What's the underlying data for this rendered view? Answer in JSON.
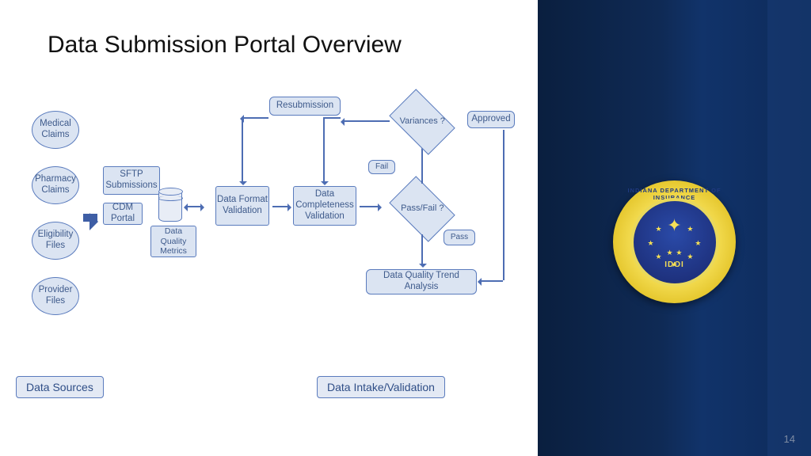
{
  "title": "Data Submission Portal Overview",
  "page_number": "14",
  "seal": {
    "org_top": "INDIANA DEPARTMENT OF INSURANCE",
    "org_bottom": "IDOI"
  },
  "diagram": {
    "sources": [
      "Medical Claims",
      "Pharmacy Claims",
      "Eligibility Files",
      "Provider Files"
    ],
    "inputs": {
      "sftp": "SFTP Submissions",
      "cdm": "CDM Portal",
      "metrics": "Data Quality Metrics"
    },
    "process": {
      "format": "Data Format Validation",
      "complete": "Data Completeness Validation",
      "passfail": "Pass/Fail ?",
      "variances": "Variances ?",
      "approved": "Approved",
      "resub": "Resubmission",
      "trend": "Data Quality Trend Analysis",
      "fail_label": "Fail",
      "pass_label": "Pass"
    },
    "sections": {
      "left": "Data Sources",
      "right": "Data Intake/Validation"
    }
  },
  "colors": {
    "node_fill": "#dbe4f2",
    "node_stroke": "#5a7bbd",
    "arrow": "#4d6db3",
    "sidebar": "#0f2a55"
  }
}
